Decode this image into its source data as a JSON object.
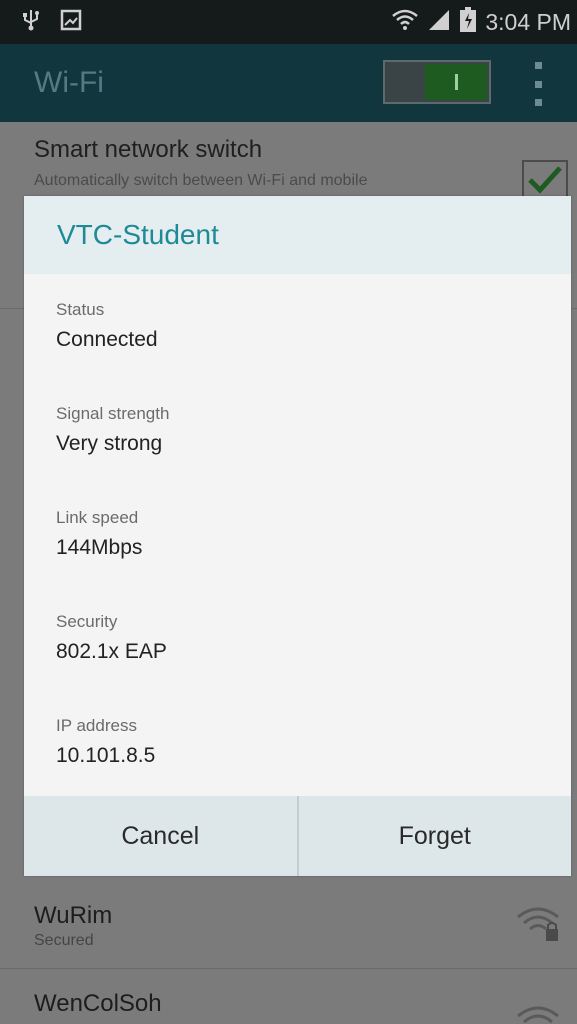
{
  "status_bar": {
    "time": "3:04 PM",
    "left_icons": [
      "usb-icon",
      "screenshot-icon"
    ],
    "right_icons": [
      "wifi-icon",
      "signal-icon",
      "battery-icon"
    ]
  },
  "app_bar": {
    "title": "Wi-Fi",
    "toggle_on": true
  },
  "background": {
    "smart_switch": {
      "title": "Smart network switch",
      "subtitle": "Automatically switch between Wi-Fi and mobile",
      "checked": true
    },
    "networks": [
      {
        "name": "WuRim",
        "status": "Secured",
        "icon": "wifi-lock-icon"
      },
      {
        "name": "WenColSoh",
        "status": "",
        "icon": "wifi-icon"
      }
    ]
  },
  "dialog": {
    "title": "VTC-Student",
    "fields": [
      {
        "label": "Status",
        "value": "Connected"
      },
      {
        "label": "Signal strength",
        "value": "Very strong"
      },
      {
        "label": "Link speed",
        "value": "144Mbps"
      },
      {
        "label": "Security",
        "value": "802.1x EAP"
      },
      {
        "label": "IP address",
        "value": "10.101.8.5"
      }
    ],
    "buttons": {
      "cancel": "Cancel",
      "forget": "Forget"
    }
  },
  "colors": {
    "accent": "#1f8a96",
    "appbar": "#12363d",
    "toggle_on": "#1d5b20",
    "dim_overlay": "#7b7b7b"
  }
}
